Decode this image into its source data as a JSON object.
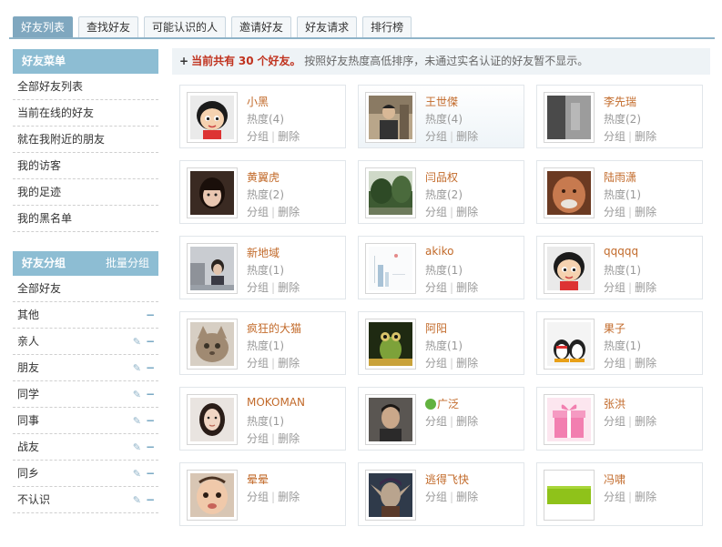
{
  "tabs": [
    "好友列表",
    "查找好友",
    "可能认识的人",
    "邀请好友",
    "好友请求",
    "排行榜"
  ],
  "menu": {
    "title": "好友菜单",
    "items": [
      "全部好友列表",
      "当前在线的好友",
      "就在我附近的朋友",
      "我的访客",
      "我的足迹",
      "我的黑名单"
    ]
  },
  "groups": {
    "title": "好友分组",
    "batch_label": "批量分组",
    "items": [
      {
        "label": "全部好友",
        "edit": false,
        "remove": false
      },
      {
        "label": "其他",
        "edit": false,
        "remove": true
      },
      {
        "label": "亲人",
        "edit": true,
        "remove": true
      },
      {
        "label": "朋友",
        "edit": true,
        "remove": true
      },
      {
        "label": "同学",
        "edit": true,
        "remove": true
      },
      {
        "label": "同事",
        "edit": true,
        "remove": true
      },
      {
        "label": "战友",
        "edit": true,
        "remove": true
      },
      {
        "label": "同乡",
        "edit": true,
        "remove": true
      },
      {
        "label": "不认识",
        "edit": true,
        "remove": true
      }
    ]
  },
  "notice": {
    "prefix": "当前共有",
    "count": "30",
    "suffix": "个好友。",
    "note": "按照好友热度高低排序，未通过实名认证的好友暂不显示。"
  },
  "ops": {
    "group": "分组",
    "delete": "删除"
  },
  "friends": [
    {
      "name": "小黑",
      "heat": "热度(4)",
      "avatar": "cartoon-girl",
      "highlight": false,
      "online": false
    },
    {
      "name": "王世傑",
      "heat": "热度(4)",
      "avatar": "photo-man",
      "highlight": true,
      "online": false
    },
    {
      "name": "李先瑞",
      "heat": "热度(2)",
      "avatar": "photo-dark",
      "highlight": false,
      "online": false
    },
    {
      "name": "黄翼虎",
      "heat": "热度(2)",
      "avatar": "photo-girl",
      "highlight": false,
      "online": false
    },
    {
      "name": "闫品权",
      "heat": "热度(2)",
      "avatar": "photo-trees",
      "highlight": false,
      "online": false
    },
    {
      "name": "陆雨潇",
      "heat": "热度(1)",
      "avatar": "photo-face",
      "highlight": false,
      "online": false
    },
    {
      "name": "新地域",
      "heat": "热度(1)",
      "avatar": "photo-street",
      "highlight": false,
      "online": false
    },
    {
      "name": "akiko",
      "heat": "热度(1)",
      "avatar": "drawing-white",
      "highlight": false,
      "online": false
    },
    {
      "name": "qqqqq",
      "heat": "热度(1)",
      "avatar": "cartoon-girl",
      "highlight": false,
      "online": false
    },
    {
      "name": "疯狂的大猫",
      "heat": "热度(1)",
      "avatar": "photo-cat",
      "highlight": false,
      "online": false
    },
    {
      "name": "阿阳",
      "heat": "热度(1)",
      "avatar": "photo-frog",
      "highlight": false,
      "online": false
    },
    {
      "name": "果子",
      "heat": "热度(1)",
      "avatar": "penguins",
      "highlight": false,
      "online": false
    },
    {
      "name": "MOKOMAN",
      "heat": "热度(1)",
      "avatar": "photo-woman",
      "highlight": false,
      "online": false
    },
    {
      "name": "广泛",
      "heat": "",
      "avatar": "photo-man2",
      "highlight": false,
      "online": true
    },
    {
      "name": "张洪",
      "heat": "",
      "avatar": "gift-pink",
      "highlight": false,
      "online": false
    },
    {
      "name": "晕晕",
      "heat": "",
      "avatar": "photo-baby",
      "highlight": false,
      "online": false
    },
    {
      "name": "逃得飞快",
      "heat": "",
      "avatar": "game-elf",
      "highlight": false,
      "online": false
    },
    {
      "name": "冯啸",
      "heat": "",
      "avatar": "green-bar",
      "highlight": false,
      "online": false
    }
  ]
}
